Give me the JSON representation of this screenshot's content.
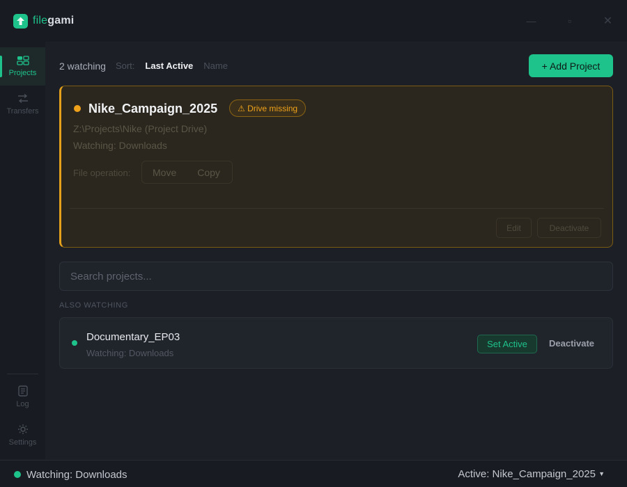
{
  "app": {
    "logo_part1": "file",
    "logo_part2": "gami",
    "minimize_glyph": "—",
    "maximize_glyph": "▫",
    "close_glyph": "✕"
  },
  "sidebar": {
    "items": [
      {
        "label": "Projects",
        "icon": "projects-icon",
        "active": true
      },
      {
        "label": "Transfers",
        "icon": "transfers-icon",
        "active": false
      },
      {
        "label": "Log",
        "icon": "log-icon",
        "active": false
      },
      {
        "label": "Settings",
        "icon": "settings-icon",
        "active": false
      }
    ]
  },
  "topbar": {
    "watching_count": "2 watching",
    "sort_label": "Sort:",
    "sort_options": [
      "Last Active",
      "Name"
    ],
    "sort_active": "Last Active",
    "add_button": "+ Add Project"
  },
  "active_project": {
    "name": "Nike_Campaign_2025",
    "badge": "⚠ Drive missing",
    "path": "Z:\\Projects\\Nike (Project Drive)",
    "watching": "Watching: Downloads",
    "file_op_label": "File operation:",
    "file_ops": [
      "Move",
      "Copy"
    ],
    "edit_button": "Edit",
    "deactivate_button": "Deactivate",
    "status_color": "#f0a31a"
  },
  "search": {
    "placeholder": "Search projects...",
    "value": ""
  },
  "also_watching": {
    "label": "ALSO WATCHING",
    "items": [
      {
        "name": "Documentary_EP03",
        "watching": "Watching: Downloads",
        "set_active": "Set Active",
        "deactivate": "Deactivate"
      }
    ]
  },
  "statusbar": {
    "watching": "Watching: Downloads",
    "active": "Active: Nike_Campaign_2025",
    "caret": "▼"
  },
  "colors": {
    "accent": "#1ec28b",
    "warning": "#f0a31a",
    "background": "#1c1f26"
  }
}
